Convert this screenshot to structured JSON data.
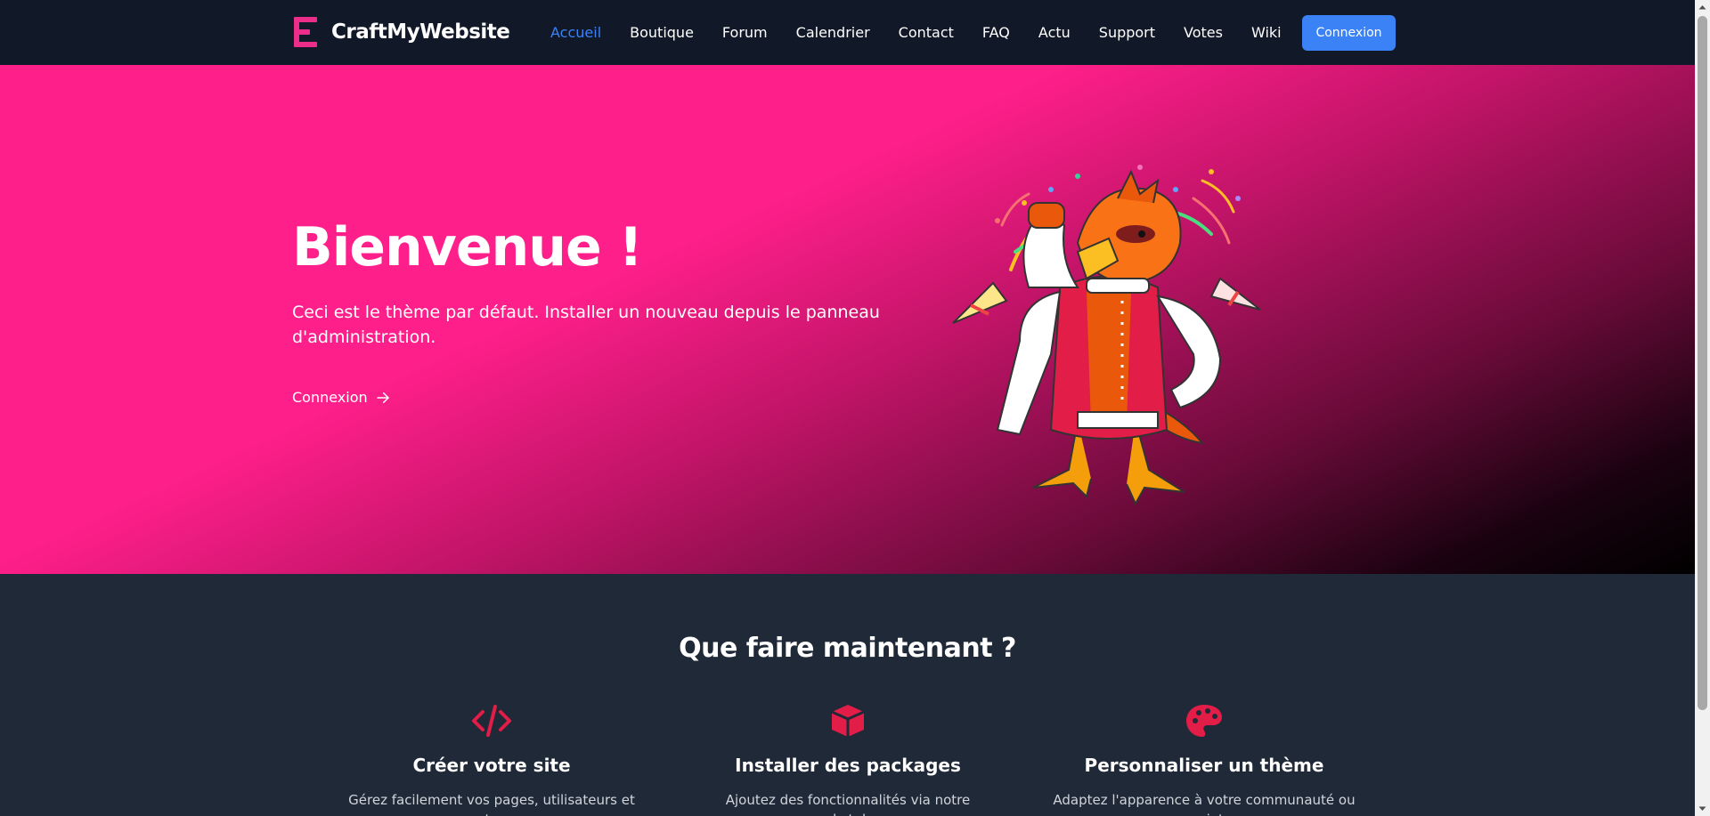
{
  "brand": {
    "name": "CraftMyWebsite",
    "accent": "#ec2e8a"
  },
  "nav": {
    "items": [
      {
        "label": "Accueil",
        "active": true
      },
      {
        "label": "Boutique"
      },
      {
        "label": "Forum"
      },
      {
        "label": "Calendrier"
      },
      {
        "label": "Contact"
      },
      {
        "label": "FAQ"
      },
      {
        "label": "Actu"
      },
      {
        "label": "Support"
      },
      {
        "label": "Votes"
      },
      {
        "label": "Wiki"
      }
    ],
    "login_label": "Connexion",
    "active_color": "#3b82f6"
  },
  "hero": {
    "title": "Bienvenue !",
    "text": "Ceci est le thème par défaut. Installer un nouveau depuis le panneau d'administration.",
    "link_label": "Connexion",
    "link_icon": "arrow-right-icon",
    "gradient": [
      "#ff1f8a",
      "#000000"
    ]
  },
  "section": {
    "title": "Que faire maintenant ?",
    "features": [
      {
        "icon": "code-icon",
        "title": "Créer votre site",
        "text": "Gérez facilement vos pages, utilisateurs et contenus"
      },
      {
        "icon": "package-icon",
        "title": "Installer des packages",
        "text": "Ajoutez des fonctionnalités via notre marketplace"
      },
      {
        "icon": "palette-icon",
        "title": "Personnaliser un thème",
        "text": "Adaptez l'apparence à votre communauté ou projet"
      }
    ],
    "icon_color": "#e11d48"
  }
}
